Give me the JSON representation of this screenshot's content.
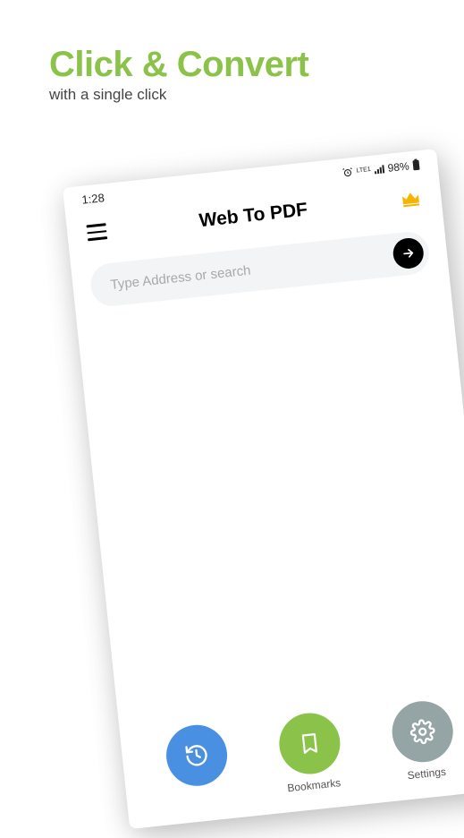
{
  "hero": {
    "title": "Click & Convert",
    "subtitle": "with a single click"
  },
  "status_bar": {
    "time": "1:28",
    "battery": "98%",
    "network_label": "LTE1"
  },
  "app": {
    "title": "Web To PDF",
    "search_placeholder": "Type Address or search"
  },
  "nav": {
    "history_label": "",
    "bookmarks_label": "Bookmarks",
    "settings_label": "Settings"
  },
  "icons": {
    "menu": "menu",
    "crown": "crown",
    "arrow": "arrow-right",
    "alarm": "alarm",
    "battery": "battery",
    "history": "history",
    "bookmark": "bookmark",
    "gear": "gear"
  },
  "colors": {
    "accent_green": "#8bc34a",
    "nav_blue": "#4a90e2",
    "nav_gray": "#95a5a6",
    "crown_gold": "#f5b400"
  }
}
